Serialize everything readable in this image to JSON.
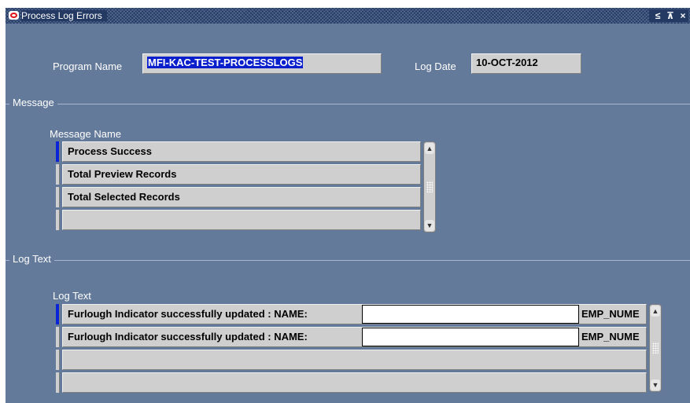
{
  "window": {
    "title": "Process Log Errors",
    "controls": [
      "≤",
      "⊼",
      "×"
    ]
  },
  "header": {
    "program_name_label": "Program Name",
    "program_name_value": "MFI-KAC-TEST-PROCESSLOGS",
    "log_date_label": "Log Date",
    "log_date_value": "10-OCT-2012"
  },
  "message_section": {
    "title": "Message",
    "column_label": "Message Name",
    "rows": [
      "Process Success",
      "Total Preview Records",
      "Total Selected Records",
      ""
    ]
  },
  "log_section": {
    "title": "Log Text",
    "column_label": "Log Text",
    "rows": [
      {
        "text": "Furlough Indicator successfully updated : NAME:",
        "suffix": "EMP_NUME"
      },
      {
        "text": "Furlough Indicator successfully updated : NAME:",
        "suffix": "EMP_NUME"
      },
      {
        "text": "",
        "suffix": ""
      },
      {
        "text": "",
        "suffix": ""
      }
    ]
  },
  "colors": {
    "background": "#647a9a",
    "titlebar": "#243a63",
    "field": "#cfcfcf",
    "selection": "#0a1fcc",
    "active_record": "#0a24d8"
  }
}
